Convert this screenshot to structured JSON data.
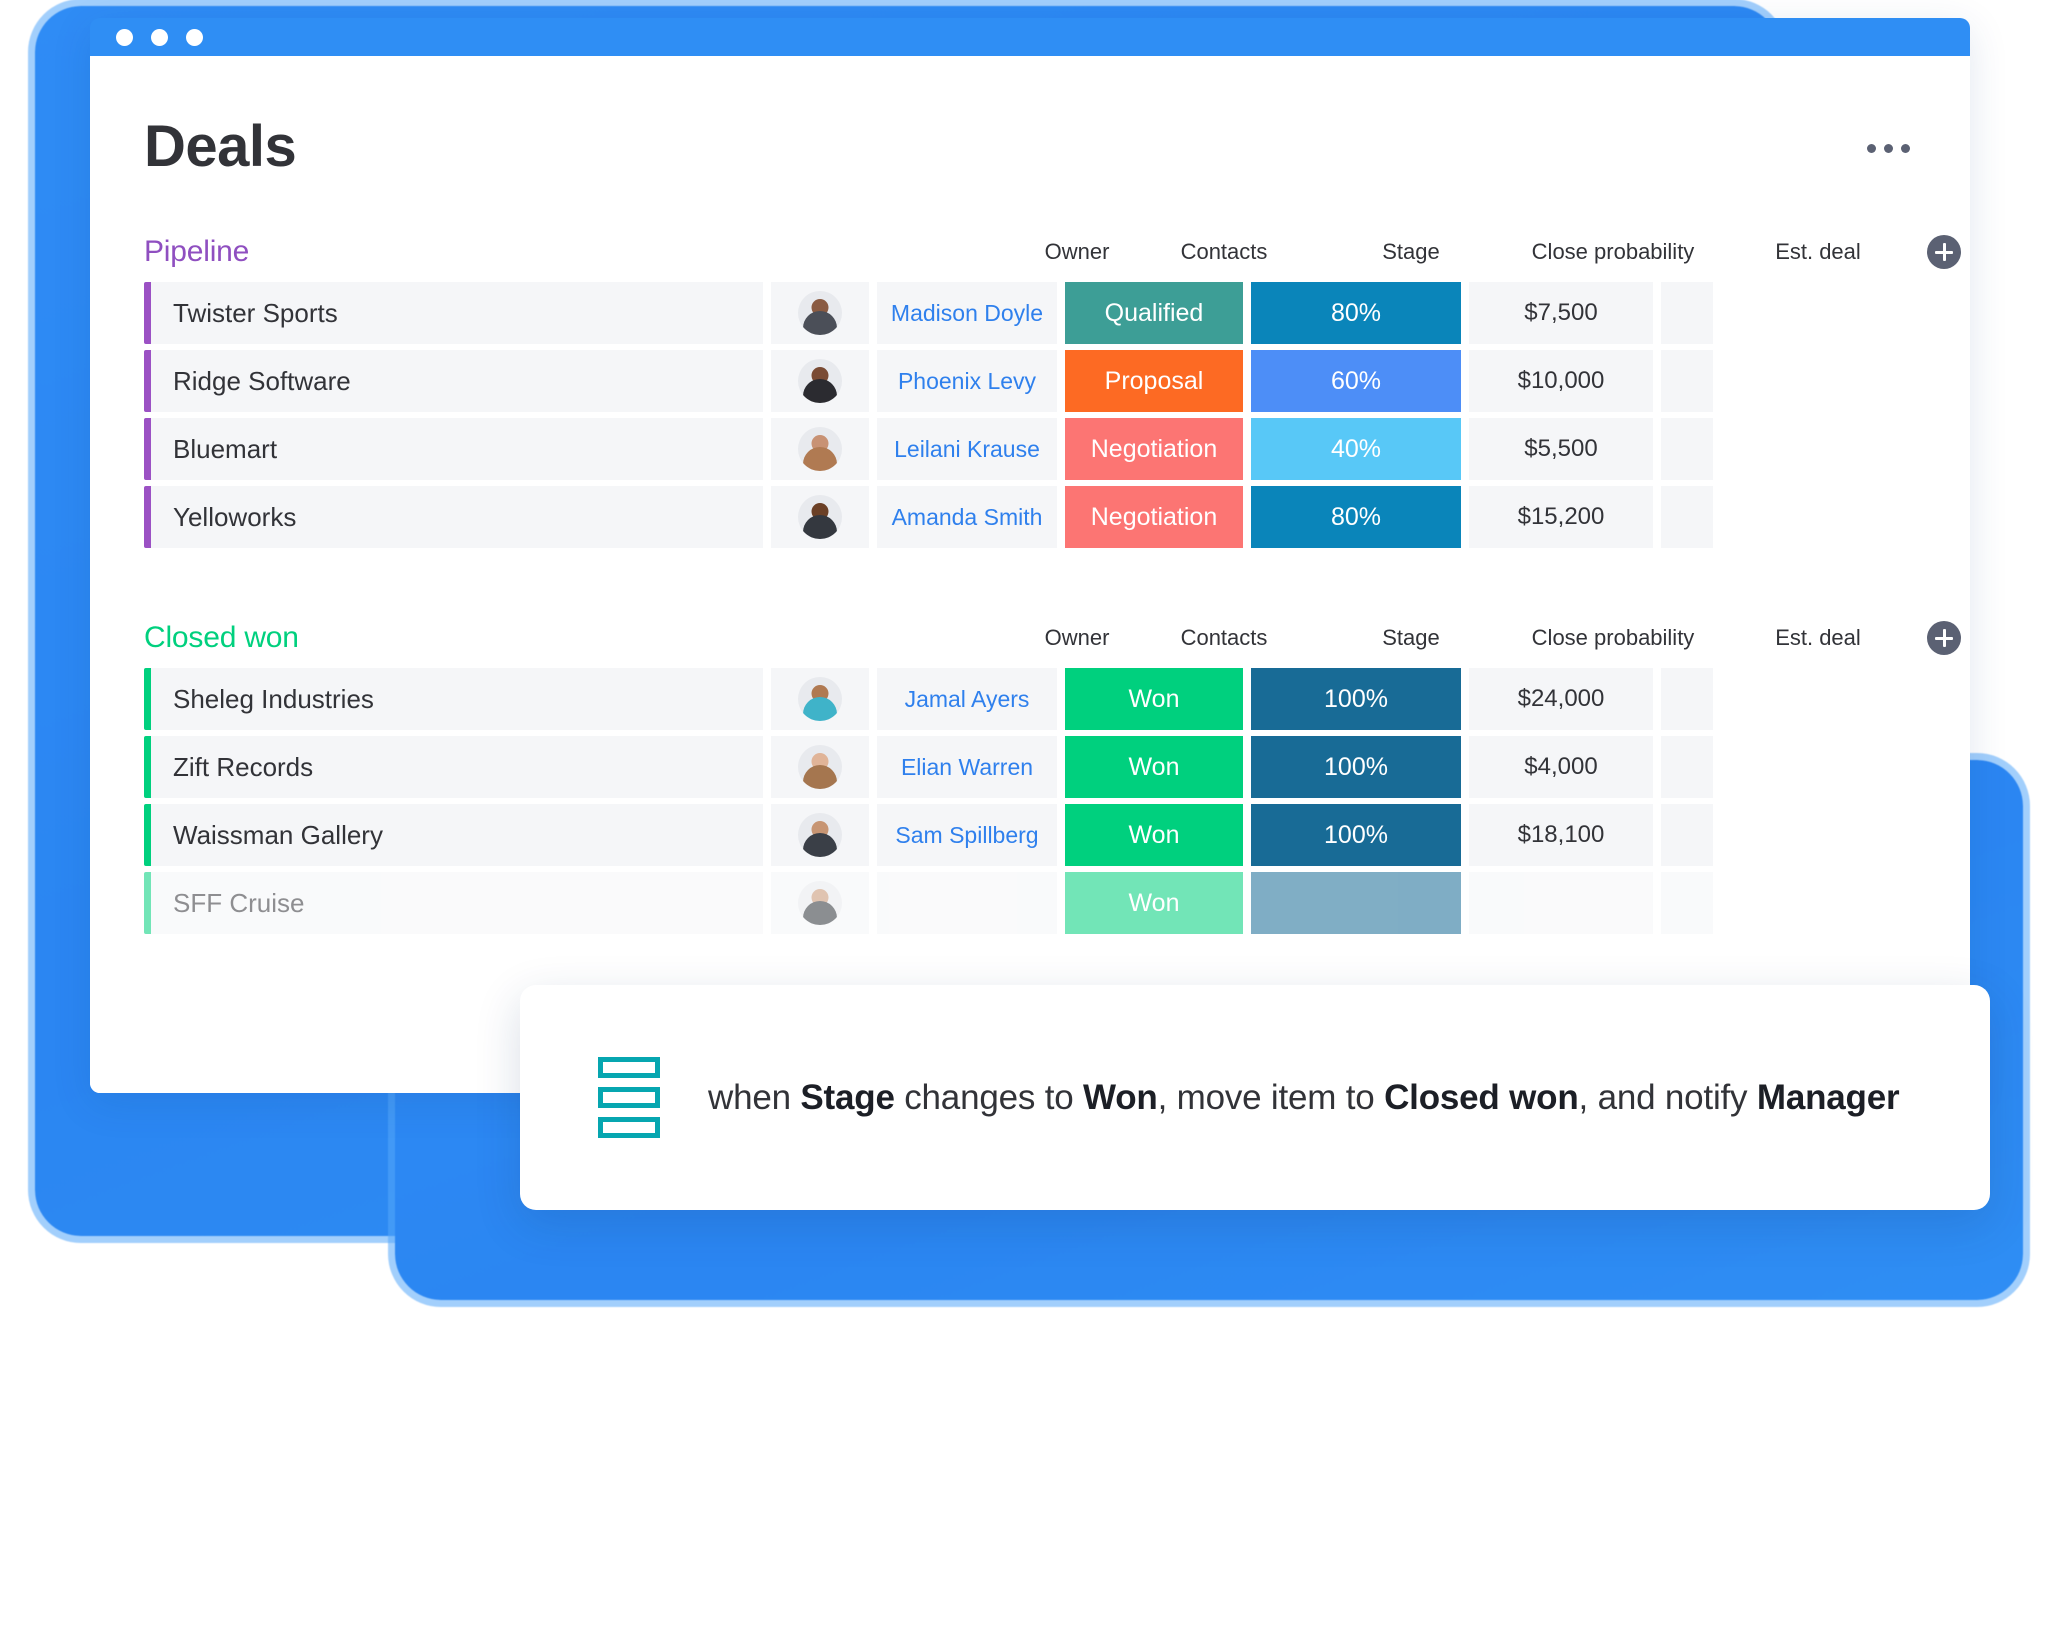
{
  "window": {
    "chrome_dots": [
      "dot-1",
      "dot-2",
      "dot-3"
    ],
    "accent_color": "#2f8ef4"
  },
  "header": {
    "title": "Deals",
    "more_menu_label": "..."
  },
  "columns": [
    "Owner",
    "Contacts",
    "Stage",
    "Close probability",
    "Est. deal"
  ],
  "groups": [
    {
      "id": "pipeline",
      "title": "Pipeline",
      "color": "#8f4fc0",
      "accent": "#9b51c4",
      "add_button_label": "+",
      "columns": {
        "owner": "Owner",
        "contacts": "Contacts",
        "stage": "Stage",
        "probability": "Close probability",
        "deal": "Est. deal"
      },
      "rows": [
        {
          "name": "Twister Sports",
          "contact": "Madison Doyle",
          "stage": "Qualified",
          "stage_color": "#3d9e96",
          "probability": "80%",
          "probability_color": "#0a85ba",
          "deal": "$7,500",
          "avatar_skin": "#8a5b42",
          "avatar_shirt": "#4b4f58"
        },
        {
          "name": "Ridge Software",
          "contact": "Phoenix Levy",
          "stage": "Proposal",
          "stage_color": "#fd6a23",
          "probability": "60%",
          "probability_color": "#4d8ef7",
          "deal": "$10,000",
          "avatar_skin": "#7a4b34",
          "avatar_shirt": "#2b2b30"
        },
        {
          "name": "Bluemart",
          "contact": "Leilani Krause",
          "stage": "Negotiation",
          "stage_color": "#fc7573",
          "probability": "40%",
          "probability_color": "#58c8f7",
          "deal": "$5,500",
          "avatar_skin": "#c89274",
          "avatar_shirt": "#b07a52"
        },
        {
          "name": "Yelloworks",
          "contact": "Amanda Smith",
          "stage": "Negotiation",
          "stage_color": "#fc7573",
          "probability": "80%",
          "probability_color": "#0a85ba",
          "deal": "$15,200",
          "avatar_skin": "#6b4026",
          "avatar_shirt": "#34383f"
        }
      ]
    },
    {
      "id": "closedwon",
      "title": "Closed won",
      "color": "#00d07e",
      "accent": "#00d07e",
      "add_button_label": "+",
      "columns": {
        "owner": "Owner",
        "contacts": "Contacts",
        "stage": "Stage",
        "probability": "Close probability",
        "deal": "Est. deal"
      },
      "rows": [
        {
          "name": "Sheleg Industries",
          "contact": "Jamal Ayers",
          "stage": "Won",
          "stage_color": "#00d07e",
          "probability": "100%",
          "probability_color": "#186b96",
          "deal": "$24,000",
          "avatar_skin": "#b07a52",
          "avatar_shirt": "#3fb3c9"
        },
        {
          "name": "Zift Records",
          "contact": "Elian Warren",
          "stage": "Won",
          "stage_color": "#00d07e",
          "probability": "100%",
          "probability_color": "#186b96",
          "deal": "$4,000",
          "avatar_skin": "#e0b498",
          "avatar_shirt": "#a5764f"
        },
        {
          "name": "Waissman Gallery",
          "contact": "Sam Spillberg",
          "stage": "Won",
          "stage_color": "#00d07e",
          "probability": "100%",
          "probability_color": "#186b96",
          "deal": "$18,100",
          "avatar_skin": "#c79573",
          "avatar_shirt": "#3a3f47"
        },
        {
          "name": "SFF Cruise",
          "contact": "",
          "stage": "Won",
          "stage_color": "#00d07e",
          "probability": "",
          "probability_color": "#186b96",
          "deal": "",
          "avatar_skin": "#c79573",
          "avatar_shirt": "#2e3238"
        }
      ]
    }
  ],
  "automation": {
    "icon_name": "automation-board-icon",
    "icon_color": "#06a6b0",
    "segments": [
      {
        "text": "when ",
        "bold": false
      },
      {
        "text": "Stage",
        "bold": true
      },
      {
        "text": " changes to ",
        "bold": false
      },
      {
        "text": "Won",
        "bold": true
      },
      {
        "text": ", move item to ",
        "bold": false
      },
      {
        "text": "Closed won",
        "bold": true
      },
      {
        "text": ", and notify ",
        "bold": false
      },
      {
        "text": "Manager",
        "bold": true
      }
    ]
  }
}
